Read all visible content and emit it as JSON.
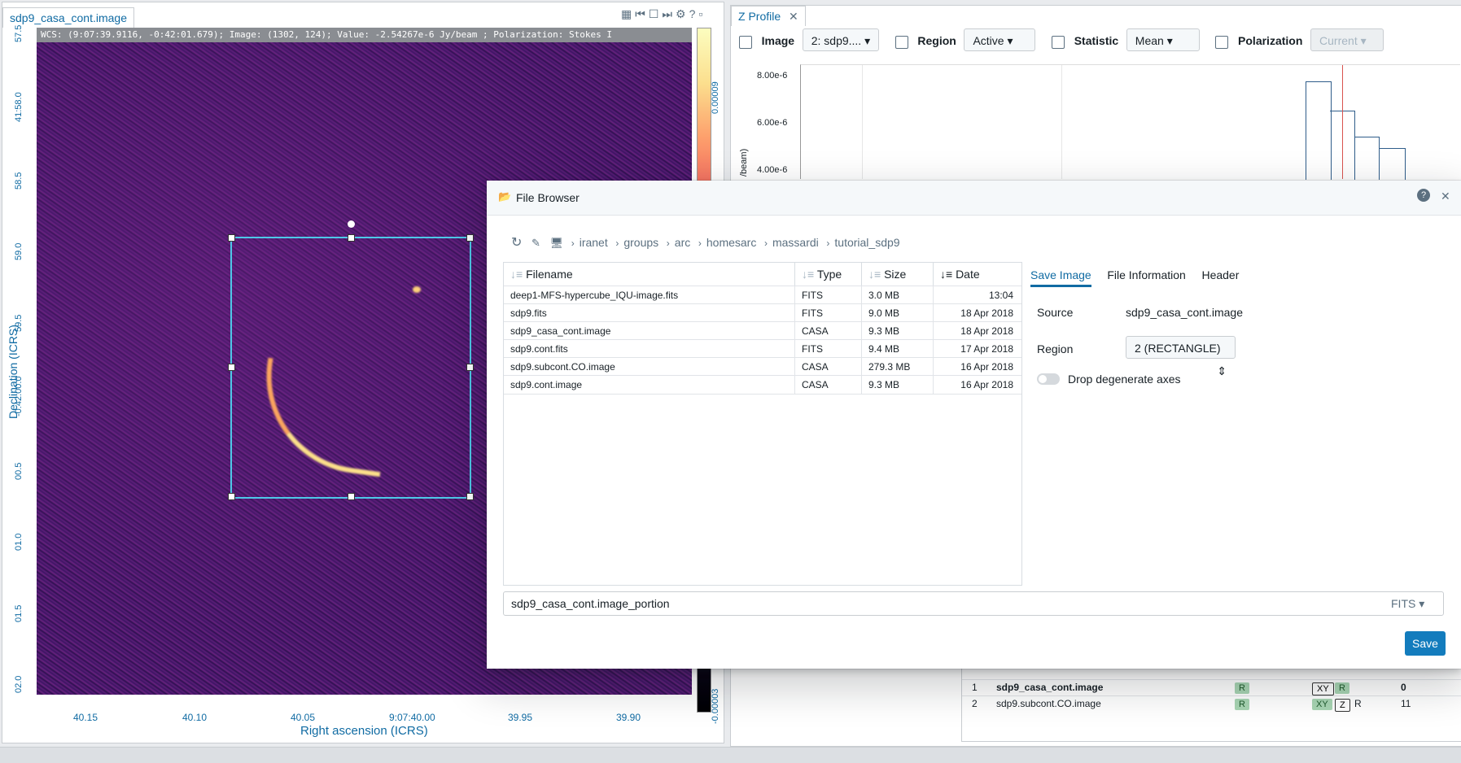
{
  "image_panel": {
    "tab_title": "sdp9_casa_cont.image",
    "cursor_info": "WCS: (9:07:39.9116, -0:42:01.679); Image: (1302, 124); Value: -2.54267e-6 Jy/beam ; Polarization: Stokes I",
    "y_axis_label": "Declination (ICRS)",
    "x_axis_label": "Right ascension (ICRS)",
    "y_ticks": [
      "57.5",
      "41:58.0",
      "58.5",
      "59.0",
      "59.5",
      "-0:42:00.0",
      "00.5",
      "01.0",
      "01.5",
      "02.0"
    ],
    "x_ticks": [
      "40.15",
      "40.10",
      "40.05",
      "9:07:40.00",
      "39.95",
      "39.90"
    ],
    "colorbar_ticks": [
      "0.00009",
      "-0.00003"
    ],
    "toolbar_icons": [
      "grid-icon",
      "first-frame-icon",
      "square-icon",
      "last-frame-icon",
      "gear-icon",
      "help-icon",
      "minimize-icon"
    ]
  },
  "zprofile": {
    "tab_title": "Z Profile",
    "image_label": "Image",
    "image_value": "2: sdp9....",
    "region_label": "Region",
    "region_value": "Active",
    "statistic_label": "Statistic",
    "statistic_value": "Mean",
    "polarization_label": "Polarization",
    "polarization_value": "Current",
    "y_ticks": [
      "8.00e-6",
      "6.00e-6",
      "4.00e-6"
    ],
    "y_label_partial": "/beam)"
  },
  "dialog": {
    "title": "File Browser",
    "breadcrumb": [
      "iranet",
      "groups",
      "arc",
      "homesarc",
      "massardi",
      "tutorial_sdp9"
    ],
    "columns": [
      "Filename",
      "Type",
      "Size",
      "Date"
    ],
    "files": [
      {
        "name": "deep1-MFS-hypercube_IQU-image.fits",
        "type": "FITS",
        "size": "3.0 MB",
        "date": "13:04"
      },
      {
        "name": "sdp9.fits",
        "type": "FITS",
        "size": "9.0 MB",
        "date": "18 Apr 2018"
      },
      {
        "name": "sdp9_casa_cont.image",
        "type": "CASA",
        "size": "9.3 MB",
        "date": "18 Apr 2018"
      },
      {
        "name": "sdp9.cont.fits",
        "type": "FITS",
        "size": "9.4 MB",
        "date": "17 Apr 2018"
      },
      {
        "name": "sdp9.subcont.CO.image",
        "type": "CASA",
        "size": "279.3 MB",
        "date": "16 Apr 2018"
      },
      {
        "name": "sdp9.cont.image",
        "type": "CASA",
        "size": "9.3 MB",
        "date": "16 Apr 2018"
      }
    ],
    "tabs": [
      "Save Image",
      "File Information",
      "Header"
    ],
    "source_label": "Source",
    "source_value": "sdp9_casa_cont.image",
    "region_label": "Region",
    "region_value": "2 (RECTANGLE)",
    "drop_label": "Drop degenerate axes",
    "filename_value": "sdp9_casa_cont.image_portion",
    "format_value": "FITS",
    "save_label": "Save"
  },
  "layers": [
    {
      "index": "1",
      "name": "sdp9_casa_cont.image",
      "value": "0"
    },
    {
      "index": "2",
      "name": "sdp9.subcont.CO.image",
      "value": "11"
    }
  ],
  "layer_badges": {
    "r": "R",
    "xy": "XY",
    "z": "Z"
  }
}
